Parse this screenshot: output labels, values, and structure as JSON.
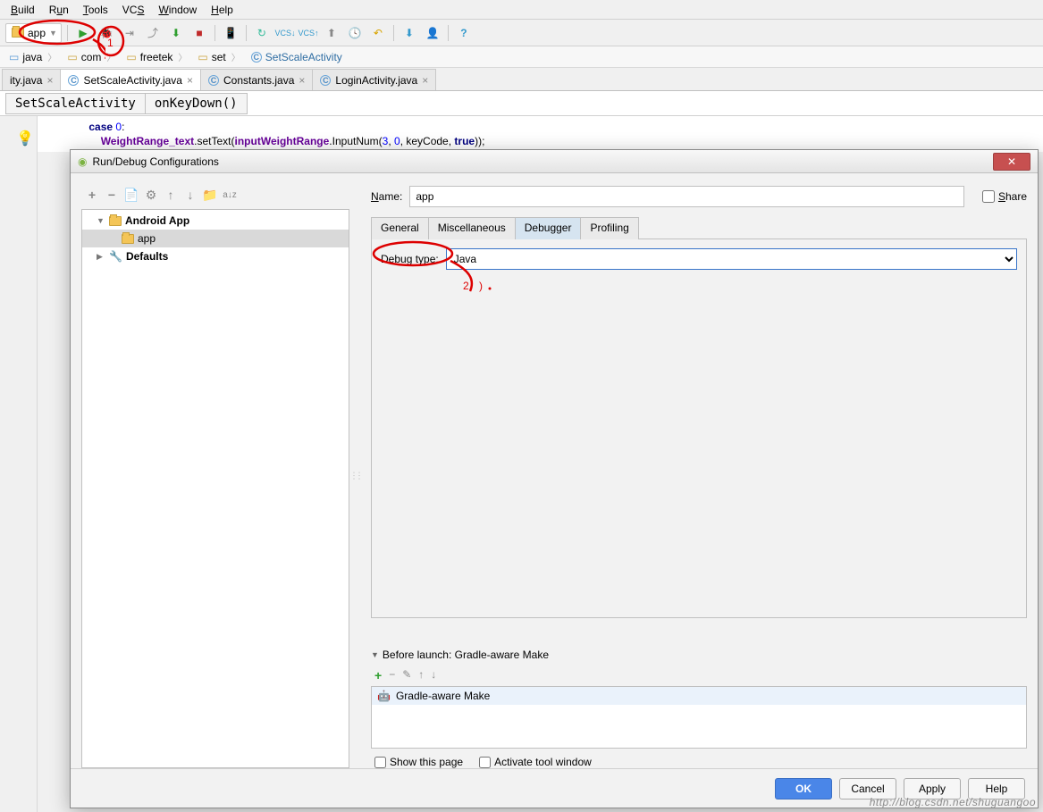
{
  "menu": {
    "items": [
      "Build",
      "Run",
      "Tools",
      "VCS",
      "Window",
      "Help"
    ],
    "underlines": [
      "B",
      "R",
      "T",
      "S",
      "W",
      "H"
    ]
  },
  "toolbar": {
    "run_combo": "app"
  },
  "breadcrumb": {
    "items": [
      "java",
      "com",
      "freetek",
      "set",
      "SetScaleActivity"
    ]
  },
  "editor_tabs": [
    {
      "label": "ity.java",
      "active": false,
      "partial": true
    },
    {
      "label": "SetScaleActivity.java",
      "active": true
    },
    {
      "label": "Constants.java",
      "active": false
    },
    {
      "label": "LoginActivity.java",
      "active": false
    }
  ],
  "methodbar": {
    "class": "SetScaleActivity",
    "method": "onKeyDown()"
  },
  "code": {
    "line1_a": "                case ",
    "line1_b": "0",
    "line1_c": ":",
    "line2_a": "                    ",
    "line2_b": "WeightRange_text",
    "line2_c": ".setText(",
    "line2_d": "inputWeightRange",
    "line2_e": ".InputNum(",
    "line2_f": "3",
    "line2_g": ", ",
    "line2_h": "0",
    "line2_i": ", keyCode, ",
    "line2_j": "true",
    "line2_k": "));"
  },
  "dialog": {
    "title": "Run/Debug Configurations",
    "name_label": "Name:",
    "name_value": "app",
    "share_label": "Share",
    "tree": {
      "root": "Android App",
      "child": "app",
      "defaults": "Defaults"
    },
    "tabs": [
      "General",
      "Miscellaneous",
      "Debugger",
      "Profiling"
    ],
    "active_tab": "Debugger",
    "debug_type_label": "Debug type:",
    "debug_type_value": "Java",
    "before_launch_label": "Before launch: Gradle-aware Make",
    "before_launch_item": "Gradle-aware Make",
    "show_this_page": "Show this page",
    "activate_tool": "Activate tool window",
    "buttons": {
      "ok": "OK",
      "cancel": "Cancel",
      "apply": "Apply",
      "help": "Help"
    }
  },
  "annotations": {
    "one": "1",
    "two": "2"
  },
  "watermark": "http://blog.csdn.net/shuguangoo"
}
